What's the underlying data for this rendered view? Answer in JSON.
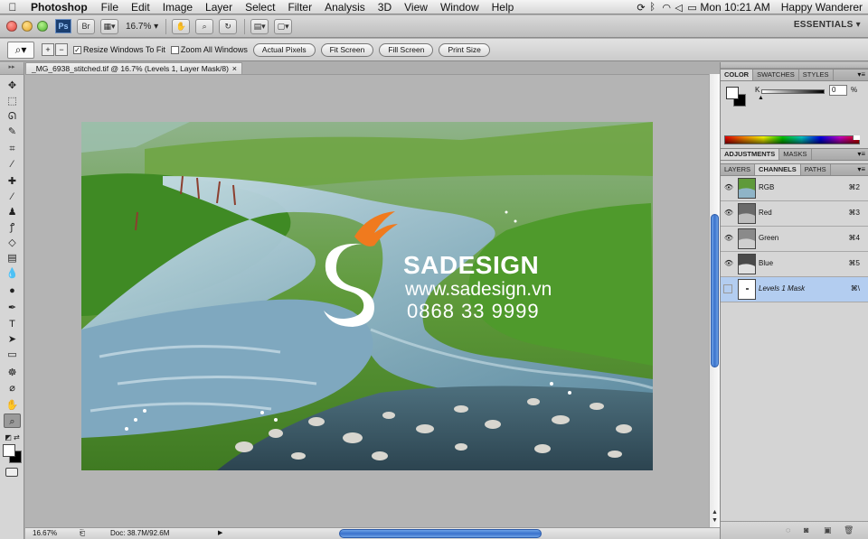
{
  "menubar": {
    "app_name": "Photoshop",
    "items": [
      "File",
      "Edit",
      "Image",
      "Layer",
      "Select",
      "Filter",
      "Analysis",
      "3D",
      "View",
      "Window",
      "Help"
    ],
    "clock": "Mon 10:21 AM",
    "user": "Happy Wanderer"
  },
  "appbar": {
    "ps_logo": "Ps",
    "bridge_label": "Br",
    "zoom": "16.7%",
    "workspace": "ESSENTIALS ▾"
  },
  "options": {
    "resize_windows": "Resize Windows To Fit",
    "resize_checked": true,
    "zoom_all": "Zoom All Windows",
    "zoom_all_checked": false,
    "actual_pixels": "Actual Pixels",
    "fit_screen": "Fit Screen",
    "fill_screen": "Fill Screen",
    "print_size": "Print Size"
  },
  "document": {
    "tab_title": "_MG_6938_stitched.tif @ 16.7% (Levels 1, Layer Mask/8)",
    "close": "×"
  },
  "watermark": {
    "brand": "SADESIGN",
    "url": "www.sadesign.vn",
    "phone": "0868 33 9999"
  },
  "status": {
    "zoom": "16.67%",
    "doc": "Doc: 38.7M/92.6M"
  },
  "color_panel": {
    "tabs": [
      "COLOR",
      "SWATCHES",
      "STYLES"
    ],
    "channel": "K",
    "value": "0",
    "unit": "%"
  },
  "adjust_panel": {
    "tabs": [
      "ADJUSTMENTS",
      "MASKS"
    ]
  },
  "channels_panel": {
    "tabs": [
      "LAYERS",
      "CHANNELS",
      "PATHS"
    ],
    "rows": [
      {
        "name": "RGB",
        "shortcut": "⌘2"
      },
      {
        "name": "Red",
        "shortcut": "⌘3"
      },
      {
        "name": "Green",
        "shortcut": "⌘4"
      },
      {
        "name": "Blue",
        "shortcut": "⌘5"
      },
      {
        "name": "Levels 1 Mask",
        "shortcut": "⌘\\"
      }
    ]
  },
  "colors": {
    "selection": "#b3cdf0",
    "scroll_accent": "#3a72cc",
    "brand_orange": "#f07a1e"
  }
}
